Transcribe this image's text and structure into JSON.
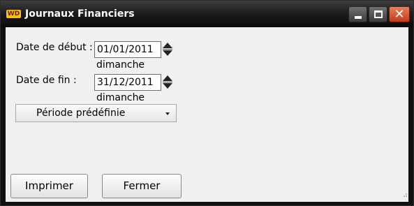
{
  "window": {
    "title": "Journaux Financiers",
    "icon": "wd-app-icon",
    "icon_text": "WD",
    "controls": {
      "minimize": "minimize",
      "maximize": "maximize",
      "close": "✕"
    }
  },
  "form": {
    "start": {
      "label": "Date de début :",
      "value": "01/01/2011",
      "weekday": "dimanche"
    },
    "end": {
      "label": "Date de fin :",
      "value": "31/12/2011",
      "weekday": "dimanche"
    },
    "period_dropdown": {
      "selected": "Période prédéfinie"
    }
  },
  "buttons": {
    "print": "Imprimer",
    "close": "Fermer"
  },
  "colors": {
    "titlebar": "#1c1c1c",
    "close_button": "#d34a25",
    "icon": "#f3c10f",
    "client": "#f0f0f0"
  }
}
